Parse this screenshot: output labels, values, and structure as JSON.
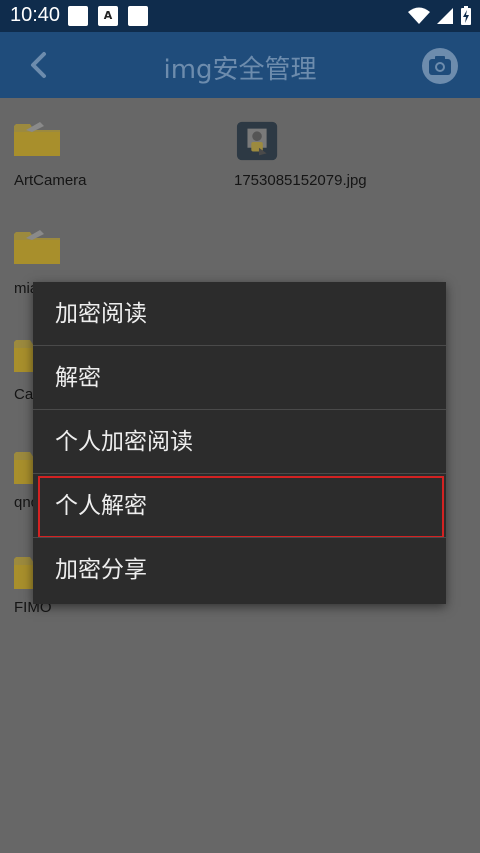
{
  "status_bar": {
    "time": "10:40",
    "notification_a": "A",
    "icons": [
      "wifi-icon",
      "signal-icon",
      "battery-charging-icon"
    ]
  },
  "app_bar": {
    "title": "img安全管理",
    "back_icon": "chevron-left-icon",
    "camera_icon": "camera-icon"
  },
  "files": [
    {
      "name": "ArtCamera",
      "type": "folder"
    },
    {
      "name": "1753085152079.jpg",
      "type": "encrypted-image"
    },
    {
      "name": "mia",
      "type": "folder"
    },
    {
      "name": "Ca",
      "type": "folder"
    },
    {
      "name": "qnc",
      "type": "folder"
    },
    {
      "name": "FIMO",
      "type": "folder"
    }
  ],
  "context_menu": {
    "items": [
      {
        "label": "加密阅读"
      },
      {
        "label": "解密"
      },
      {
        "label": "个人加密阅读"
      },
      {
        "label": "个人解密",
        "highlighted": true
      },
      {
        "label": "加密分享"
      }
    ]
  },
  "colors": {
    "status_bar": "#0f2c4c",
    "app_bar": "#1f4c7b",
    "menu_bg": "#2c2c2c",
    "highlight": "#d32222",
    "folder": "#e8c23c"
  }
}
